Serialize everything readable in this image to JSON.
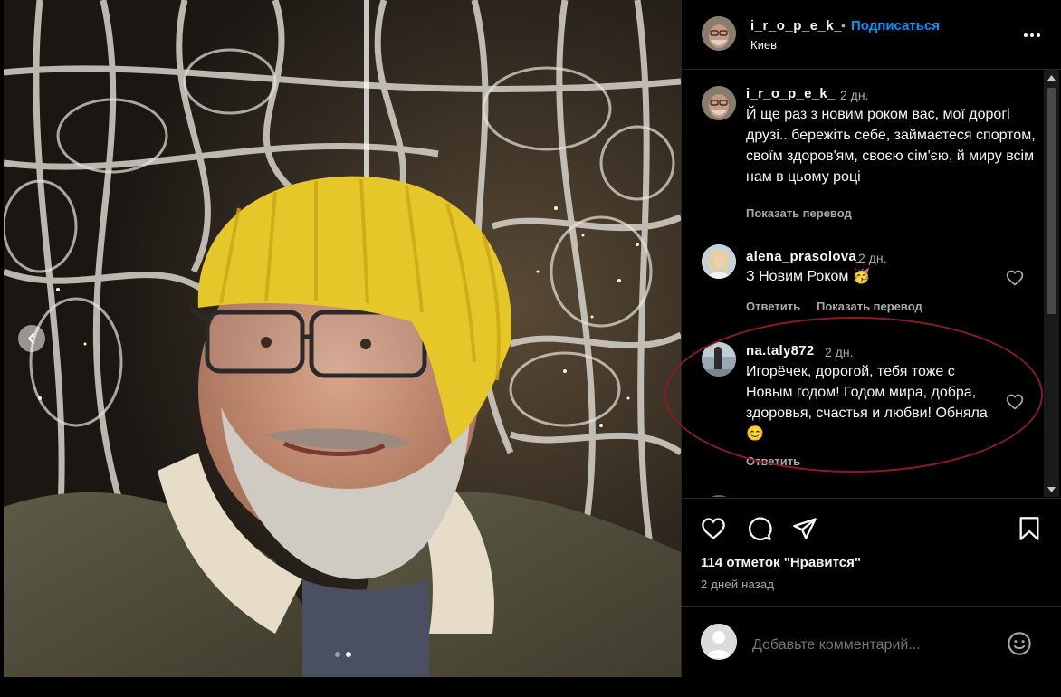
{
  "header": {
    "username": "i_r_o_p_e_k_",
    "separator": "•",
    "follow_label": "Подписаться",
    "location": "Киев"
  },
  "caption": {
    "username": "i_r_o_p_e_k_",
    "time": "2 дн.",
    "text": "Й ще раз з новим роком вас, мої дорогі друзі.. бережіть себе, займаєтеся спортом, своїм здоров'ям, своєю сім'єю, й миру всім нам в цьому році",
    "translate_label": "Показать перевод"
  },
  "comments": [
    {
      "username": "alena_prasolova_",
      "time": "2 дн.",
      "text": "З Новим Роком 🥳",
      "reply_label": "Ответить",
      "translate_label": "Показать перевод"
    },
    {
      "username": "na.taly872",
      "time": "2 дн.",
      "text": "Игорёчек, дорогой, тебя тоже с Новым годом! Годом мира, добра, здоровья, счастья и любви! Обняла😊",
      "reply_label": "Ответить"
    }
  ],
  "actions": {
    "like_icon": "heart-icon",
    "comment_icon": "comment-bubble-icon",
    "share_icon": "paper-plane-icon",
    "save_icon": "bookmark-icon"
  },
  "likes_text": "114 отметок \"Нравится\"",
  "posted_ago": "2 дней назад",
  "add_comment": {
    "placeholder": "Добавьте комментарий..."
  },
  "carousel": {
    "total": 2,
    "active": 2
  },
  "colors": {
    "background": "#000000",
    "link_blue": "#0095f6",
    "secondary_text": "#a8a8a8",
    "annotation": "#8b1a24"
  }
}
